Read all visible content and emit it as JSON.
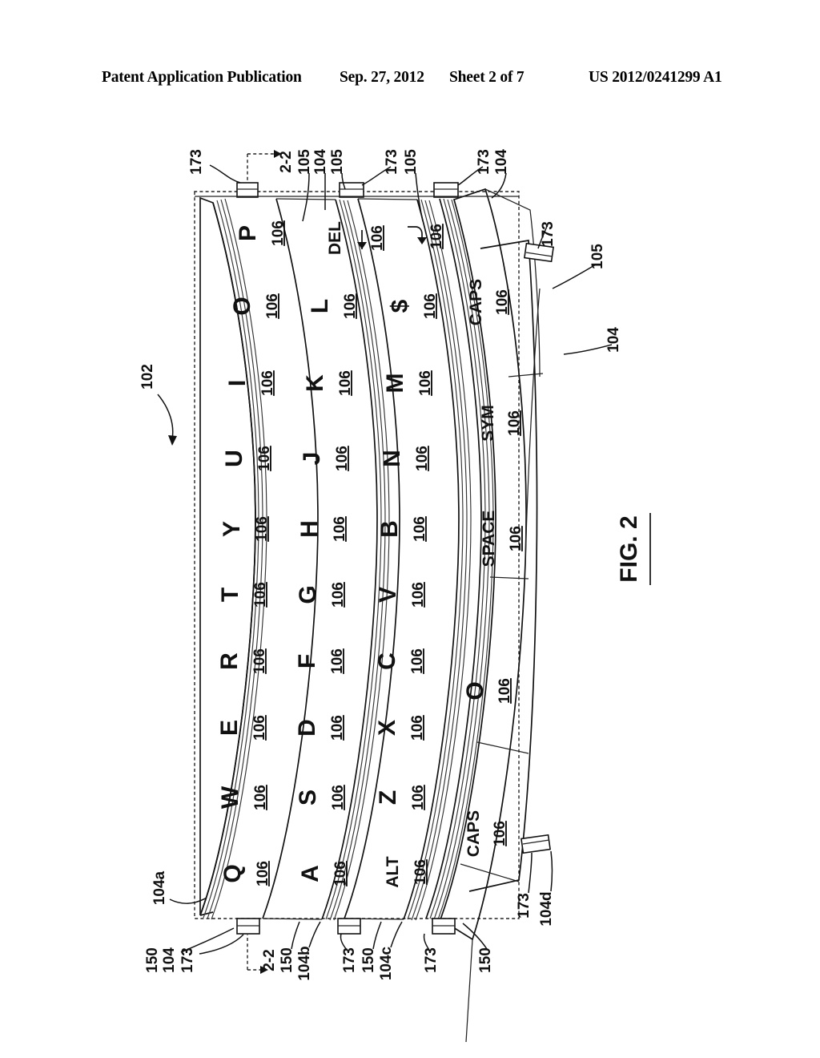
{
  "header": {
    "publication": "Patent Application Publication",
    "date": "Sep. 27, 2012",
    "sheet": "Sheet 2 of 7",
    "number": "US 2012/0241299 A1"
  },
  "figure": {
    "caption": "FIG. 2",
    "device_ref": "102",
    "section_marker": "2-2",
    "key_ref": "106",
    "panel_ref": "104",
    "edge_ref": "105",
    "tab_ref": "173",
    "hinge_ref": "150"
  },
  "keyboard": {
    "rows": [
      {
        "panel_ref": "104a",
        "keys": [
          {
            "label": "Q",
            "type": "letter",
            "ref": "106"
          },
          {
            "label": "W",
            "type": "letter",
            "ref": "106"
          },
          {
            "label": "E",
            "type": "letter",
            "ref": "106"
          },
          {
            "label": "R",
            "type": "letter",
            "ref": "106"
          },
          {
            "label": "T",
            "type": "letter",
            "ref": "106"
          },
          {
            "label": "Y",
            "type": "letter",
            "ref": "106"
          },
          {
            "label": "U",
            "type": "letter",
            "ref": "106"
          },
          {
            "label": "I",
            "type": "letter",
            "ref": "106"
          },
          {
            "label": "O",
            "type": "letter",
            "ref": "106"
          },
          {
            "label": "P",
            "type": "letter",
            "ref": "106"
          }
        ]
      },
      {
        "panel_ref": "104b",
        "keys": [
          {
            "label": "A",
            "type": "letter",
            "ref": "106"
          },
          {
            "label": "S",
            "type": "letter",
            "ref": "106"
          },
          {
            "label": "D",
            "type": "letter",
            "ref": "106"
          },
          {
            "label": "F",
            "type": "letter",
            "ref": "106"
          },
          {
            "label": "G",
            "type": "letter",
            "ref": "106"
          },
          {
            "label": "H",
            "type": "letter",
            "ref": "106"
          },
          {
            "label": "J",
            "type": "letter",
            "ref": "106"
          },
          {
            "label": "K",
            "type": "letter",
            "ref": "106"
          },
          {
            "label": "L",
            "type": "letter",
            "ref": "106"
          },
          {
            "label": "DEL",
            "type": "delete",
            "ref": "106"
          }
        ]
      },
      {
        "panel_ref": "104c",
        "keys": [
          {
            "label": "ALT",
            "type": "word",
            "ref": "106"
          },
          {
            "label": "Z",
            "type": "letter",
            "ref": "106"
          },
          {
            "label": "X",
            "type": "letter",
            "ref": "106"
          },
          {
            "label": "C",
            "type": "letter",
            "ref": "106"
          },
          {
            "label": "V",
            "type": "letter",
            "ref": "106"
          },
          {
            "label": "B",
            "type": "letter",
            "ref": "106"
          },
          {
            "label": "N",
            "type": "letter",
            "ref": "106"
          },
          {
            "label": "M",
            "type": "letter",
            "ref": "106"
          },
          {
            "label": "$",
            "type": "letter",
            "ref": "106"
          },
          {
            "label": "↵",
            "type": "enter",
            "ref": "106"
          }
        ]
      },
      {
        "panel_ref": "104d",
        "keys": [
          {
            "label": "CAPS",
            "type": "word",
            "ref": "106"
          },
          {
            "label": "O",
            "type": "letter",
            "ref": "106"
          },
          {
            "label": "SPACE",
            "type": "word",
            "ref": "106"
          },
          {
            "label": "SYM",
            "type": "word",
            "ref": "106"
          },
          {
            "label": "CAPS",
            "type": "word",
            "ref": "106"
          }
        ]
      }
    ]
  },
  "callouts": {
    "top_edge": [
      "173",
      "2-2",
      "105",
      "104",
      "105",
      "173",
      "105",
      "173",
      "104"
    ],
    "bottom_edge": [
      "104a",
      "150",
      "104",
      "173",
      "2-2",
      "150",
      "104b",
      "173",
      "150",
      "104c",
      "173",
      "150"
    ],
    "right_side": [
      "173",
      "105",
      "104"
    ],
    "bottom_right": [
      "173",
      "104d"
    ]
  }
}
